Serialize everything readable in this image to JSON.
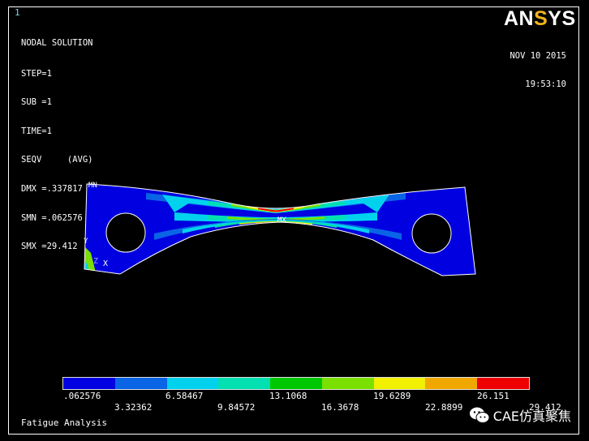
{
  "window": {
    "number": "1"
  },
  "logo": {
    "part1": "AN",
    "accent": "S",
    "part2": "YS"
  },
  "status": {
    "lines": [
      "NODAL SOLUTION",
      "STEP=1",
      "SUB =1",
      "TIME=1",
      "SEQV     (AVG)",
      "DMX =.337817",
      "SMN =.062576",
      "SMX =29.412"
    ]
  },
  "date": {
    "day": "NOV 10 2015",
    "time": "19:53:10"
  },
  "markers": {
    "min": "MN",
    "max": "MX",
    "axis_y": "Y",
    "axis_z": "Z",
    "axis_x": "X"
  },
  "legend": {
    "colors": [
      "#0000e0",
      "#0a64e6",
      "#00d2ee",
      "#00e0b0",
      "#00c800",
      "#7ae000",
      "#f0f000",
      "#f0a800",
      "#ee0000"
    ],
    "labels_top": [
      ".062576",
      "6.58467",
      "13.1068",
      "19.6289",
      "26.151"
    ],
    "labels_bottom": [
      "3.32362",
      "9.84572",
      "16.3678",
      "22.8899",
      "29.412"
    ]
  },
  "caption": "Fatigue Analysis",
  "watermark": {
    "text": "CAE仿真聚焦",
    "icon": "wechat-icon"
  }
}
